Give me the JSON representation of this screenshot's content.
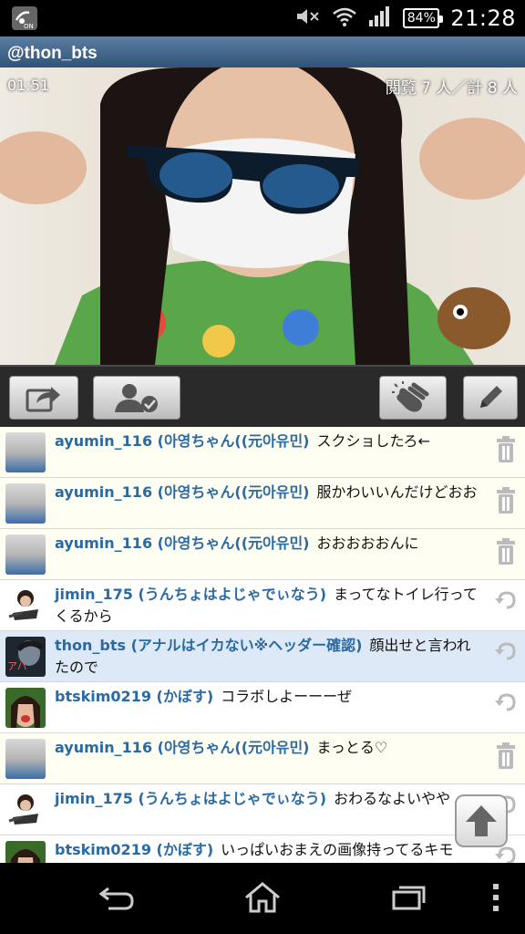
{
  "status_bar": {
    "time": "21:28",
    "battery": "84%",
    "icons": [
      "app-on-icon",
      "mute-icon",
      "wifi-icon",
      "signal-icon",
      "battery-icon"
    ]
  },
  "header": {
    "title": "@thon_bts"
  },
  "video": {
    "elapsed": "01:51",
    "viewers": "閲覧 7 人／計 8 人"
  },
  "toolbar": {
    "buttons": [
      "share-icon",
      "follow-user-icon",
      "clap-icon",
      "pencil-icon"
    ]
  },
  "comments": [
    {
      "user": "ayumin_116 (아영ちゃん((元아유민)",
      "text": "スクショしたろ←",
      "action": "trash-icon"
    },
    {
      "user": "ayumin_116 (아영ちゃん((元아유민)",
      "text": "服かわいいんだけどおお",
      "action": "trash-icon"
    },
    {
      "user": "ayumin_116 (아영ちゃん((元아유민)",
      "text": "おおおおおんに",
      "action": "trash-icon"
    },
    {
      "user": "jimin_175 (うんちょはよじゃでぃなう)",
      "text": "まってなトイレ行ってくるから",
      "action": "reply-icon"
    },
    {
      "user": "thon_bts (アナルはイカない※ヘッダー確認)",
      "text": "顔出せと言われたので",
      "action": "reply-icon"
    },
    {
      "user": "btskim0219 (かぼす)",
      "text": "コラボしよーーーぜ",
      "action": "reply-icon"
    },
    {
      "user": "ayumin_116 (아영ちゃん((元아유민)",
      "text": "まっとる♡",
      "action": "trash-icon"
    },
    {
      "user": "jimin_175 (うんちょはよじゃでぃなう)",
      "text": "おわるなよいやや",
      "action": "reply-icon"
    },
    {
      "user": "btskim0219 (かぼす)",
      "text": "いっぱいおまえの画像持ってるキモ",
      "action": "reply-icon"
    }
  ],
  "colors": {
    "username": "#2a6aa3",
    "titlebar": "#3f6489",
    "highlight_row": "#dde9f6"
  }
}
